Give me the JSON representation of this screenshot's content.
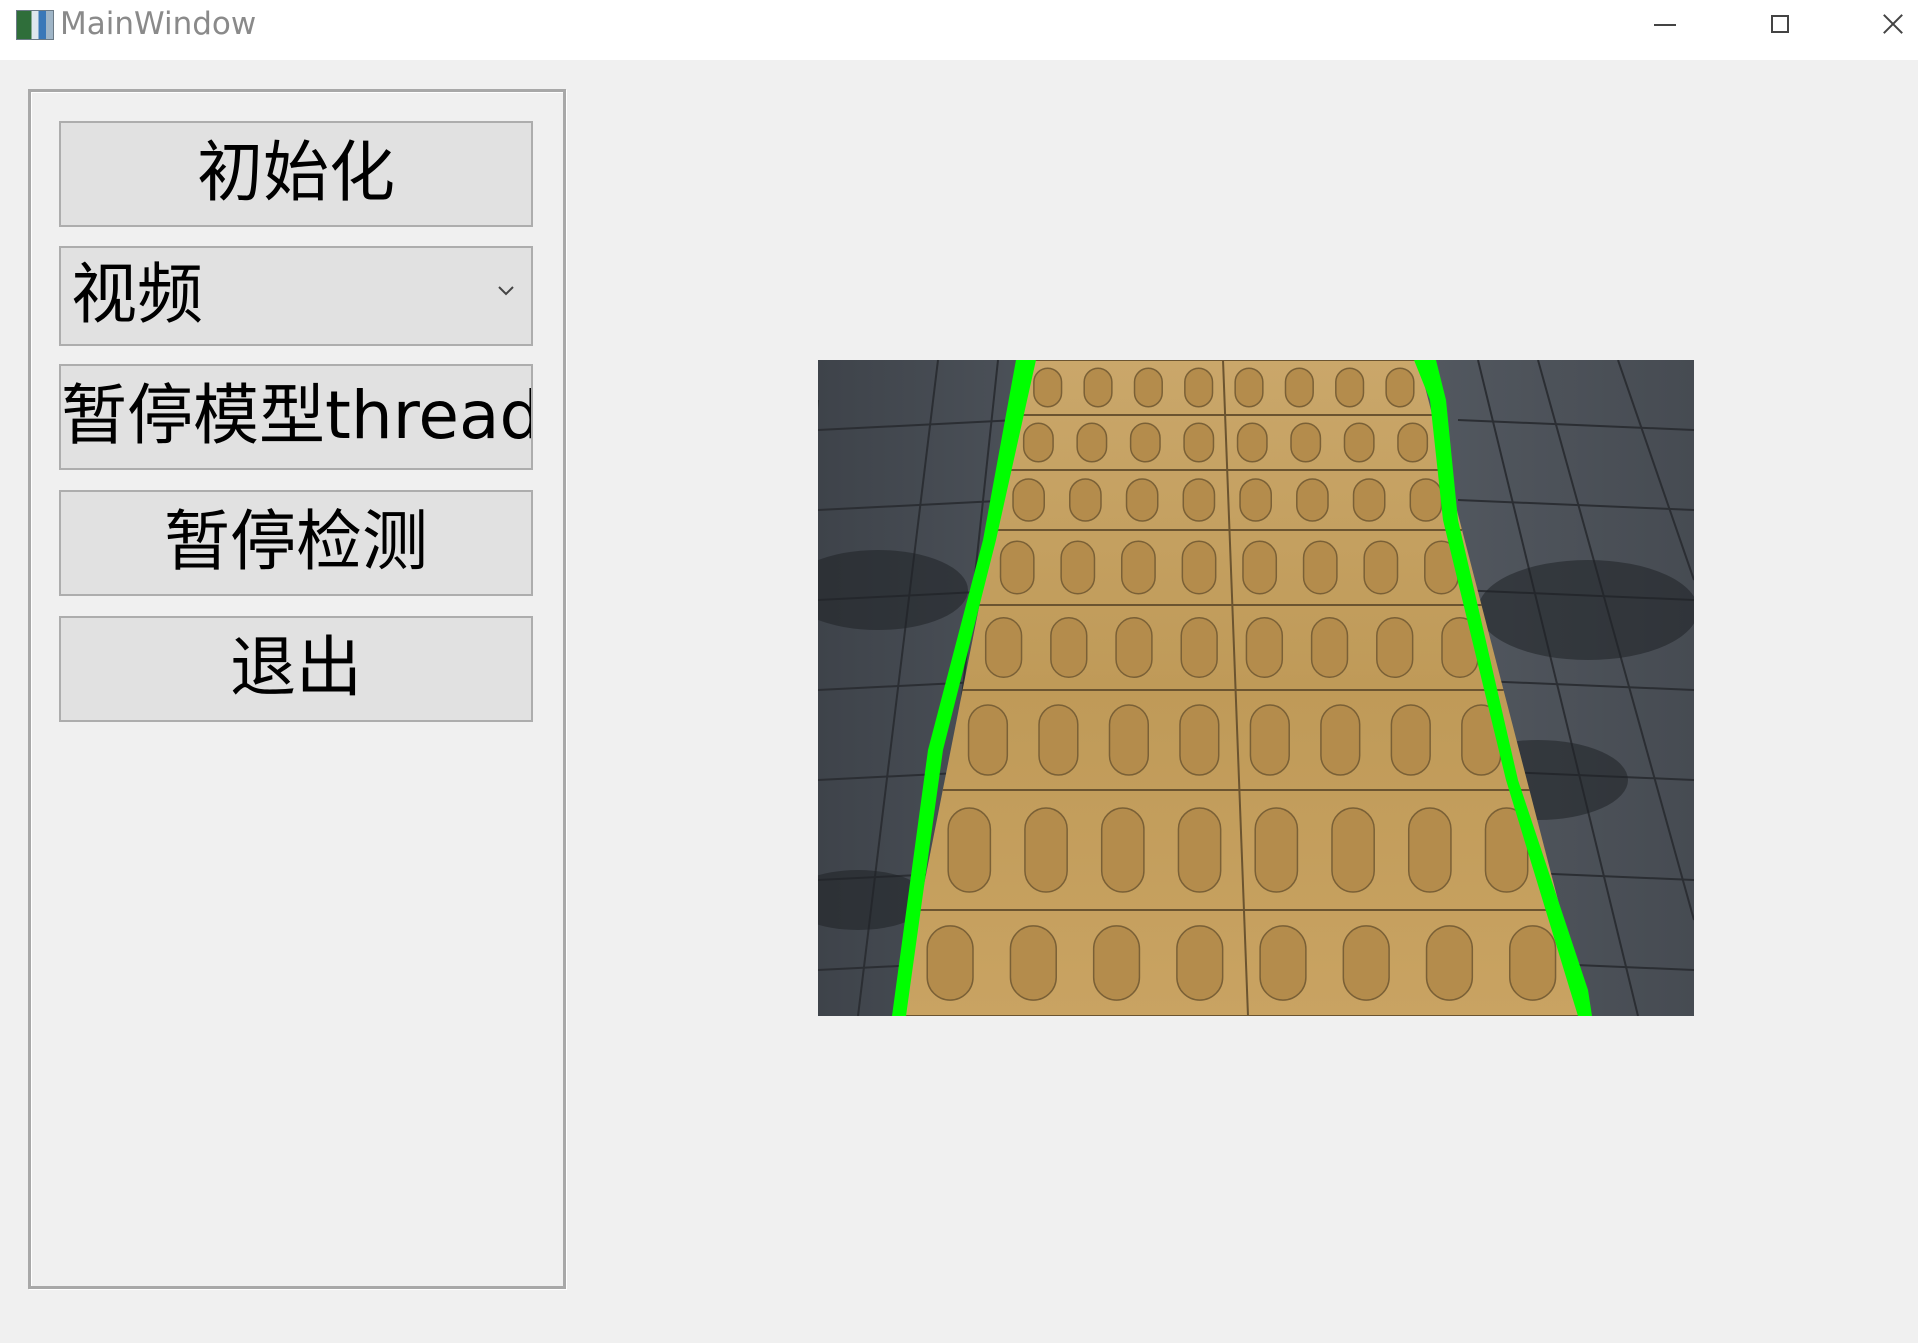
{
  "window": {
    "title": "MainWindow",
    "controls": [
      "minimize",
      "maximize",
      "close"
    ]
  },
  "panel": {
    "init_button": "初始化",
    "source_select": {
      "selected": "视频"
    },
    "pause_model_thread_button": "暂停模型thread",
    "pause_detection_button": "暂停检测",
    "exit_button": "退出"
  },
  "display": {
    "content": "tactile-paving-with-green-boundary-lines",
    "boundary_line_color": "#00ff00",
    "paving_color": "#c9a15c",
    "pavement_color": "#4a4f57"
  }
}
